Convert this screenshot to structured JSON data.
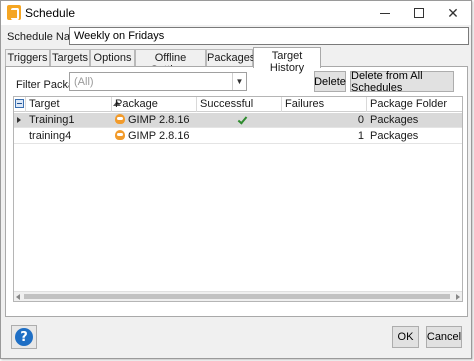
{
  "window": {
    "title": "Schedule",
    "minimize_icon": "minimize-icon",
    "maximize_icon": "maximize-icon",
    "close_label": "✕"
  },
  "schedule": {
    "name_label": "Schedule Name",
    "name_value": "Weekly on Fridays"
  },
  "tabs": [
    {
      "label": "Triggers"
    },
    {
      "label": "Targets"
    },
    {
      "label": "Options"
    },
    {
      "label": "Offline Settings"
    },
    {
      "label": "Packages"
    },
    {
      "label": "Target History",
      "active": true
    }
  ],
  "filter": {
    "label": "Filter Package",
    "placeholder": "(All)"
  },
  "buttons": {
    "delete": "Delete",
    "delete_all": "Delete from All Schedules",
    "ok": "OK",
    "cancel": "Cancel",
    "help": "?"
  },
  "grid": {
    "columns": [
      "Target",
      "Package",
      "Successful",
      "Failures",
      "Package Folder"
    ],
    "sort_column": "Target",
    "rows": [
      {
        "target": "Training1",
        "package": "GIMP 2.8.16",
        "successful": true,
        "failures": "0",
        "folder": "Packages",
        "selected": true
      },
      {
        "target": "training4",
        "package": "GIMP 2.8.16",
        "successful": false,
        "failures": "1",
        "folder": "Packages",
        "selected": false
      }
    ]
  },
  "colors": {
    "accent": "#1f6fc5",
    "success": "#2e8b2e",
    "app_icon": "#f5a623",
    "selected_row": "#d9d9d9"
  }
}
